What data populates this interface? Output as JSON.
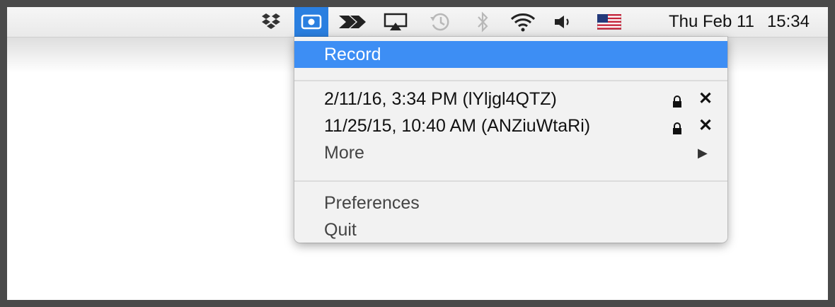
{
  "menubar": {
    "icons": [
      "dropbox-icon",
      "screen-record-icon",
      "sharing-arrows-icon",
      "airplay-icon",
      "time-machine-icon",
      "bluetooth-icon",
      "wifi-icon",
      "volume-icon",
      "us-flag-icon"
    ],
    "clock": {
      "date": "Thu Feb 11",
      "time": "15:34"
    },
    "accent": "#2a7fe0"
  },
  "menu": {
    "record": "Record",
    "recordings": [
      {
        "label": "2/11/16, 3:34 PM (lYljgl4QTZ)",
        "lock_icon": "lock-icon",
        "close_icon": "close-icon",
        "close_glyph": "✕"
      },
      {
        "label": "11/25/15, 10:40 AM (ANZiuWtaRi)",
        "lock_icon": "lock-icon",
        "close_icon": "close-icon",
        "close_glyph": "✕"
      }
    ],
    "more": "More",
    "more_arrow": "▶",
    "preferences": "Preferences",
    "quit": "Quit",
    "highlight_color": "#3d8ef4"
  }
}
